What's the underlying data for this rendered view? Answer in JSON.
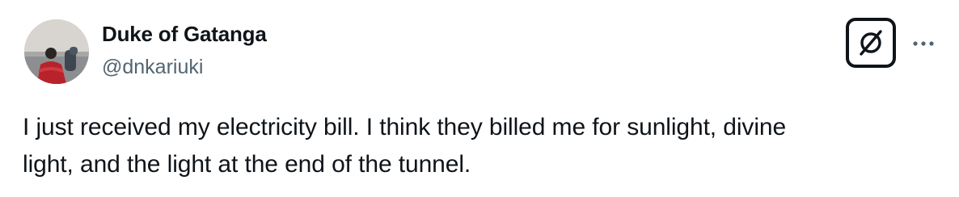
{
  "author": {
    "display_name": "Duke of Gatanga",
    "handle": "@dnkariuki"
  },
  "icons": {
    "grok": "grok-icon",
    "more": "more-horizontal-icon"
  },
  "tweet": {
    "text_lines": [
      "I just received my electricity bill. I think they billed me for sunlight, divine",
      "light, and the light at the end of the tunnel."
    ]
  },
  "colors": {
    "primary_text": "#0f1419",
    "secondary_text": "#536471",
    "background": "#ffffff"
  }
}
